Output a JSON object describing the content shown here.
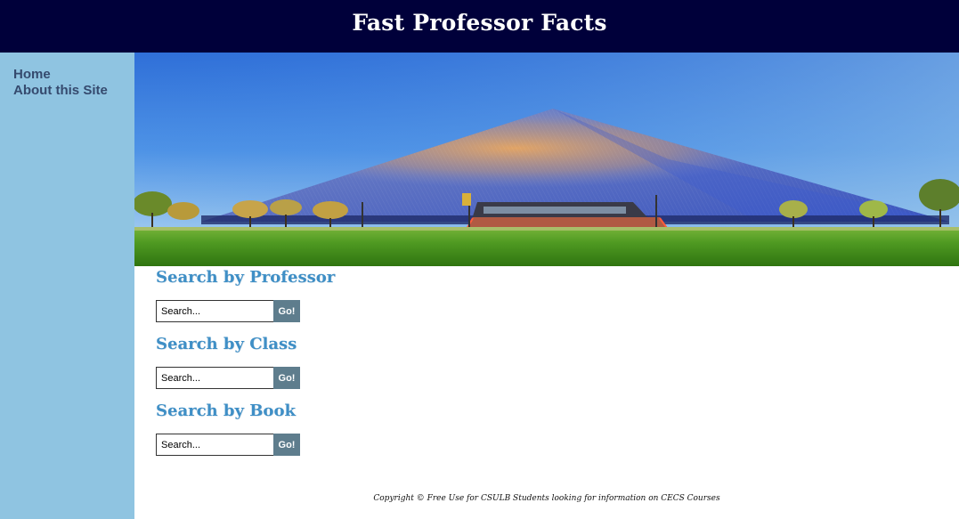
{
  "header": {
    "title": "Fast Professor Facts"
  },
  "sidebar": {
    "items": [
      {
        "label": "Home"
      },
      {
        "label": "About this Site"
      }
    ]
  },
  "hero": {
    "image": "pyramid-building-photo"
  },
  "sections": [
    {
      "title": "Search by Professor",
      "placeholder": "Search...",
      "button": "Go!"
    },
    {
      "title": "Search by Class",
      "placeholder": "Search...",
      "button": "Go!"
    },
    {
      "title": "Search by Book",
      "placeholder": "Search...",
      "button": "Go!"
    }
  ],
  "footer": {
    "text": "Copyright © Free Use for CSULB Students looking for information on CECS Courses"
  },
  "colors": {
    "header_bg": "#00003a",
    "sidebar_bg": "#8fc4e1",
    "nav_text": "#354a6e",
    "section_title": "#3f8fc6",
    "go_button": "#5e7d8d"
  }
}
